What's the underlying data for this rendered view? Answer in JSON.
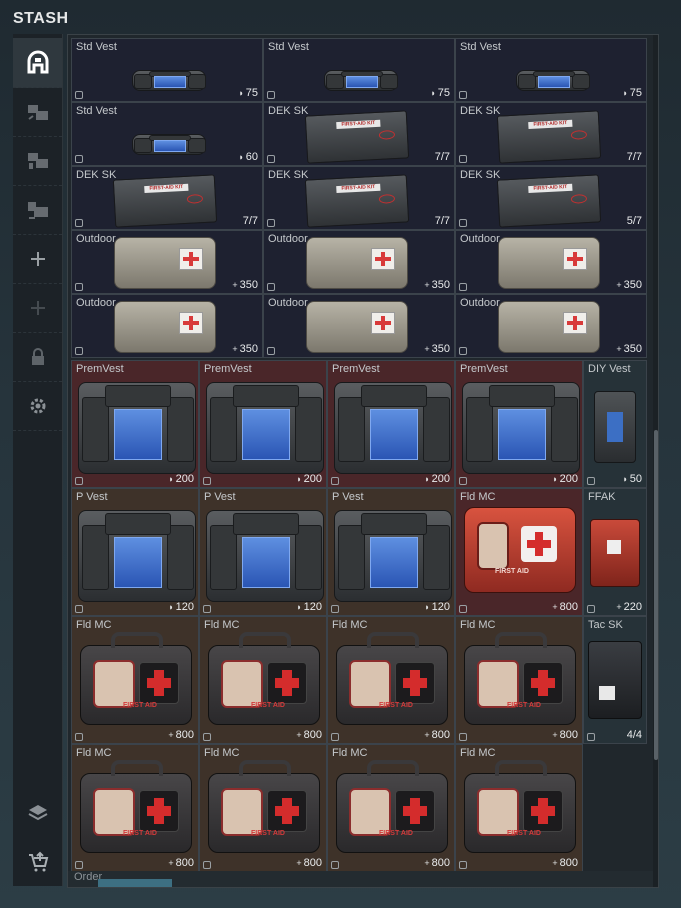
{
  "title": "STASH",
  "sidebar": {
    "items": [
      {
        "name": "stash-icon",
        "active": true
      },
      {
        "name": "gear-transfer-1-icon",
        "active": false
      },
      {
        "name": "gear-transfer-2-icon",
        "active": false
      },
      {
        "name": "gear-transfer-3-icon",
        "active": false
      },
      {
        "name": "add-icon",
        "active": false
      },
      {
        "name": "add-disabled-icon",
        "active": false
      },
      {
        "name": "lock-icon",
        "active": false
      },
      {
        "name": "settings-icon",
        "active": false
      },
      {
        "name": "layers-icon",
        "active": false
      },
      {
        "name": "cart-upgrade-icon",
        "active": false
      }
    ]
  },
  "items": [
    {
      "name": "Std Vest",
      "value": "75",
      "icon": "shield",
      "type": "vest"
    },
    {
      "name": "Std Vest",
      "value": "75",
      "icon": "shield",
      "type": "vest"
    },
    {
      "name": "Std Vest",
      "value": "75",
      "icon": "shield",
      "type": "vest"
    },
    {
      "name": "Std Vest",
      "value": "60",
      "icon": "shield",
      "type": "vest"
    },
    {
      "name": "DEK SK",
      "value": "7/7",
      "icon": "",
      "type": "kit",
      "label": "FIRST-AID KIT"
    },
    {
      "name": "DEK SK",
      "value": "7/7",
      "icon": "",
      "type": "kit",
      "label": "FIRST-AID KIT"
    },
    {
      "name": "DEK SK",
      "value": "7/7",
      "icon": "",
      "type": "kit",
      "label": "FIRST-AID KIT"
    },
    {
      "name": "DEK SK",
      "value": "7/7",
      "icon": "",
      "type": "kit",
      "label": "FIRST-AID KIT"
    },
    {
      "name": "DEK SK",
      "value": "5/7",
      "icon": "",
      "type": "kit",
      "label": "FIRST-AID KIT"
    },
    {
      "name": "Outdoor",
      "value": "350",
      "icon": "plus",
      "type": "bag"
    },
    {
      "name": "Outdoor",
      "value": "350",
      "icon": "plus",
      "type": "bag"
    },
    {
      "name": "Outdoor",
      "value": "350",
      "icon": "plus",
      "type": "bag"
    },
    {
      "name": "Outdoor",
      "value": "350",
      "icon": "plus",
      "type": "bag"
    },
    {
      "name": "Outdoor",
      "value": "350",
      "icon": "plus",
      "type": "bag"
    },
    {
      "name": "Outdoor",
      "value": "350",
      "icon": "plus",
      "type": "bag"
    },
    {
      "name": "PremVest",
      "value": "200",
      "icon": "shield",
      "type": "vestL"
    },
    {
      "name": "PremVest",
      "value": "200",
      "icon": "shield",
      "type": "vestL"
    },
    {
      "name": "PremVest",
      "value": "200",
      "icon": "shield",
      "type": "vestL"
    },
    {
      "name": "PremVest",
      "value": "200",
      "icon": "shield",
      "type": "vestL"
    },
    {
      "name": "DIY Vest",
      "value": "50",
      "icon": "shield",
      "type": "diy"
    },
    {
      "name": "P Vest",
      "value": "120",
      "icon": "shield",
      "type": "vestP"
    },
    {
      "name": "P Vest",
      "value": "120",
      "icon": "shield",
      "type": "vestP"
    },
    {
      "name": "P Vest",
      "value": "120",
      "icon": "shield",
      "type": "vestP"
    },
    {
      "name": "Fld MC",
      "value": "800",
      "icon": "plus",
      "type": "redcase",
      "label": "FIRST AID"
    },
    {
      "name": "FFAK",
      "value": "220",
      "icon": "plus",
      "type": "ffak"
    },
    {
      "name": "Fld MC",
      "value": "800",
      "icon": "plus",
      "type": "case",
      "label": "FIRST AID"
    },
    {
      "name": "Fld MC",
      "value": "800",
      "icon": "plus",
      "type": "case",
      "label": "FIRST AID"
    },
    {
      "name": "Fld MC",
      "value": "800",
      "icon": "plus",
      "type": "case",
      "label": "FIRST AID"
    },
    {
      "name": "Fld MC",
      "value": "800",
      "icon": "plus",
      "type": "case",
      "label": "FIRST AID"
    },
    {
      "name": "Tac SK",
      "value": "4/4",
      "icon": "",
      "type": "tac"
    },
    {
      "name": "Fld MC",
      "value": "800",
      "icon": "plus",
      "type": "case",
      "label": "FIRST AID"
    },
    {
      "name": "Fld MC",
      "value": "800",
      "icon": "plus",
      "type": "case",
      "label": "FIRST AID"
    },
    {
      "name": "Fld MC",
      "value": "800",
      "icon": "plus",
      "type": "case",
      "label": "FIRST AID"
    },
    {
      "name": "Fld MC",
      "value": "800",
      "icon": "plus",
      "type": "case",
      "label": "FIRST AID"
    }
  ],
  "bottom_row": {
    "label": "Order"
  },
  "colors": {
    "blue_bg": "#1e2130",
    "red_bg": "#4a2629",
    "brown_bg": "#3e3229",
    "green_bg": "#263238",
    "accent_blue": "#3d6f82"
  }
}
